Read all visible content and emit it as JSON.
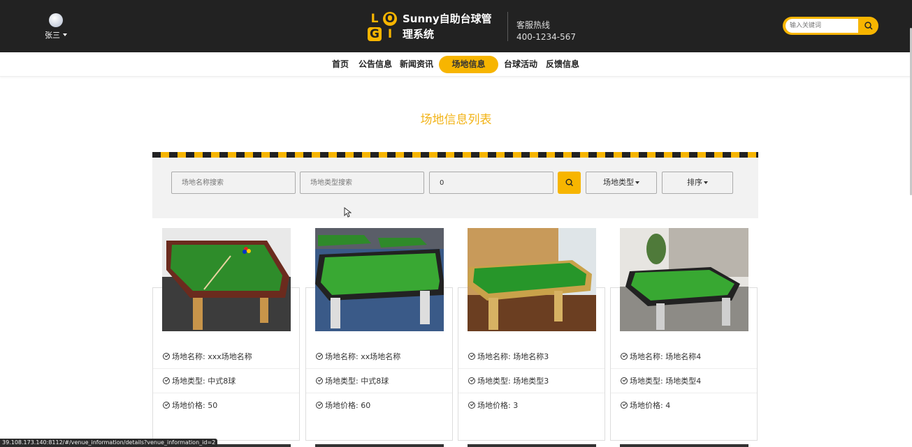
{
  "header": {
    "user_name": "张三",
    "brand_title": "Sunny自助台球管理系统",
    "logo_letters": [
      "L",
      "O",
      "G",
      "I"
    ],
    "hotline_label": "客服热线",
    "hotline_number": "400-1234-567",
    "search_placeholder": "输入关键词"
  },
  "nav": {
    "items": [
      {
        "label": "首页"
      },
      {
        "label": "公告信息"
      },
      {
        "label": "新闻资讯"
      },
      {
        "label": "场地信息",
        "active": true
      },
      {
        "label": "台球活动"
      },
      {
        "label": "反馈信息"
      }
    ]
  },
  "page_title": "场地信息列表",
  "filters": {
    "name_placeholder": "场地名称搜索",
    "type_placeholder": "场地类型搜索",
    "price_value": "0",
    "type_dropdown": "场地类型",
    "sort_dropdown": "排序"
  },
  "cards": [
    {
      "name_label": "场地名称:",
      "name": "xxx场地名称",
      "type_label": "场地类型:",
      "type": "中式8球",
      "price_label": "场地价格:",
      "price": "50"
    },
    {
      "name_label": "场地名称:",
      "name": "xx场地名称",
      "type_label": "场地类型:",
      "type": "中式8球",
      "price_label": "场地价格:",
      "price": "60"
    },
    {
      "name_label": "场地名称:",
      "name": "场地名称3",
      "type_label": "场地类型:",
      "type": "场地类型3",
      "price_label": "场地价格:",
      "price": "3"
    },
    {
      "name_label": "场地名称:",
      "name": "场地名称4",
      "type_label": "场地类型:",
      "type": "场地类型4",
      "price_label": "场地价格:",
      "price": "4"
    }
  ],
  "status_url": "39.108.173.140:8112/#/venue_information/details?venue_information_id=2",
  "colors": {
    "accent": "#f7b500",
    "header_bg": "#222222",
    "title": "#f2b317",
    "table_felt": "#2f8a2a"
  }
}
